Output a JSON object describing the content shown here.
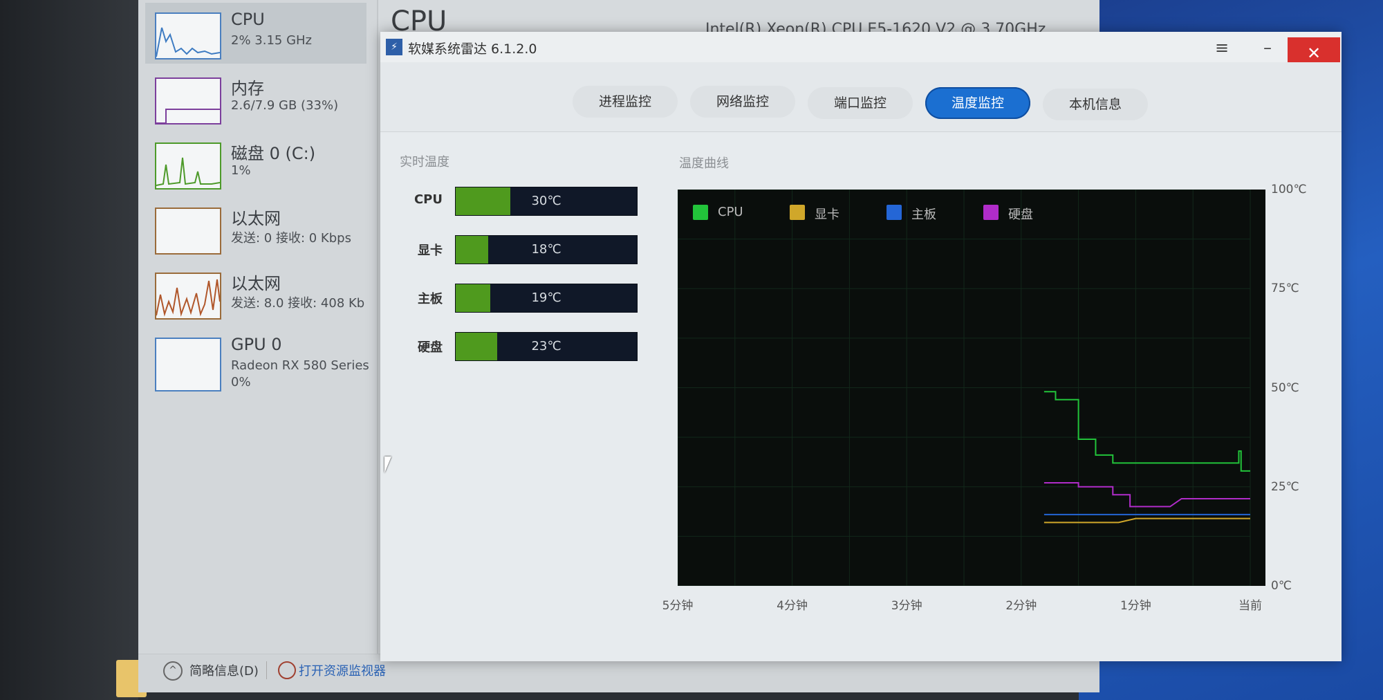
{
  "task_manager": {
    "sidebar": [
      {
        "title": "CPU",
        "sub": "2% 3.15 GHz",
        "sub2": ""
      },
      {
        "title": "内存",
        "sub": "2.6/7.9 GB (33%)",
        "sub2": ""
      },
      {
        "title": "磁盘 0 (C:)",
        "sub": "1%",
        "sub2": ""
      },
      {
        "title": "以太网",
        "sub": "发送: 0 接收: 0 Kbps",
        "sub2": ""
      },
      {
        "title": "以太网",
        "sub": "发送: 8.0 接收: 408 Kb",
        "sub2": ""
      },
      {
        "title": "GPU 0",
        "sub": "Radeon RX 580 Series",
        "sub2": "0%"
      }
    ],
    "header": "CPU",
    "processor": "Intel(R) Xeon(R) CPU E5-1620 V2 @ 3.70GHz",
    "footer": {
      "fewer_details": "简略信息(D)",
      "open_monitor": "打开资源监视器"
    }
  },
  "app": {
    "title": "软媒系统雷达 6.1.2.0",
    "tabs": [
      {
        "label": "进程监控",
        "active": false
      },
      {
        "label": "网络监控",
        "active": false
      },
      {
        "label": "端口监控",
        "active": false
      },
      {
        "label": "温度监控",
        "active": true
      },
      {
        "label": "本机信息",
        "active": false
      }
    ],
    "realtime_label": "实时温度",
    "curve_label": "温度曲线",
    "temps": [
      {
        "name": "CPU",
        "value": "30℃",
        "fraction": 0.3
      },
      {
        "name": "显卡",
        "value": "18℃",
        "fraction": 0.18
      },
      {
        "name": "主板",
        "value": "19℃",
        "fraction": 0.19
      },
      {
        "name": "硬盘",
        "value": "23℃",
        "fraction": 0.23
      }
    ],
    "colors": {
      "accent": "#1b6fd1",
      "bar_fill": "#4f9a1e",
      "close": "#d9302d"
    }
  },
  "chart_data": {
    "type": "line",
    "x_ticks": [
      "5分钟",
      "4分钟",
      "3分钟",
      "2分钟",
      "1分钟",
      "当前"
    ],
    "y_ticks": [
      "100℃",
      "75℃",
      "50℃",
      "25℃",
      "0℃"
    ],
    "ylim": [
      0,
      100
    ],
    "xlim": [
      -5,
      0
    ],
    "grid": true,
    "legend_position": "top-left",
    "series": [
      {
        "name": "CPU",
        "color": "#22c33a",
        "x": [
          -1.8,
          -1.7,
          -1.7,
          -1.5,
          -1.5,
          -1.35,
          -1.35,
          -1.2,
          -1.2,
          -0.7,
          -0.7,
          -0.6,
          -0.6,
          -0.45,
          -0.45,
          -0.1,
          -0.1,
          -0.08,
          -0.08,
          0.0
        ],
        "y": [
          49,
          49,
          47,
          47,
          37,
          37,
          33,
          33,
          31,
          31,
          31,
          31,
          31,
          31,
          31,
          31,
          34,
          34,
          29,
          29
        ]
      },
      {
        "name": "显卡",
        "color": "#d0a72a",
        "x": [
          -1.8,
          -1.15,
          -1.0,
          -0.2,
          0.0
        ],
        "y": [
          16,
          16,
          17,
          17,
          17
        ]
      },
      {
        "name": "主板",
        "color": "#2466d6",
        "x": [
          -1.8,
          -1.0,
          0.0
        ],
        "y": [
          18,
          18,
          18
        ]
      },
      {
        "name": "硬盘",
        "color": "#b02cc9",
        "x": [
          -1.8,
          -1.5,
          -1.5,
          -1.2,
          -1.2,
          -1.05,
          -1.05,
          -0.7,
          -0.7,
          -0.6,
          -0.6,
          0.0
        ],
        "y": [
          26,
          26,
          25,
          25,
          23,
          23,
          20,
          20,
          20,
          22,
          22,
          22
        ]
      }
    ]
  }
}
